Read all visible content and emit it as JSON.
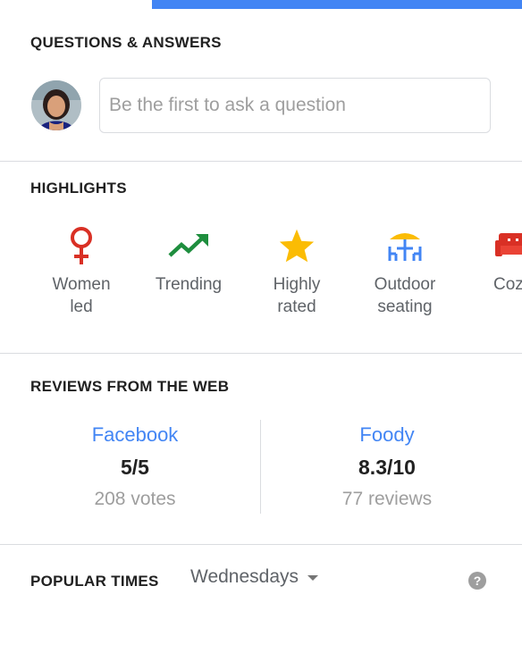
{
  "qa": {
    "title": "QUESTIONS & ANSWERS",
    "input_placeholder": "Be the first to ask a question"
  },
  "highlights": {
    "title": "HIGHLIGHTS",
    "items": [
      {
        "label_line1": "Women",
        "label_line2": "led",
        "icon": "female-symbol-icon",
        "color": "#d93025"
      },
      {
        "label_line1": "Trending",
        "label_line2": "",
        "icon": "trending-up-icon",
        "color": "#1e8e3e"
      },
      {
        "label_line1": "Highly",
        "label_line2": "rated",
        "icon": "star-icon",
        "color": "#fbbc04"
      },
      {
        "label_line1": "Outdoor",
        "label_line2": "seating",
        "icon": "outdoor-seating-icon",
        "color": "#4285f4"
      },
      {
        "label_line1": "Coz",
        "label_line2": "",
        "icon": "sofa-icon",
        "color": "#d93025"
      }
    ]
  },
  "reviews": {
    "title": "REVIEWS FROM THE WEB",
    "sources": [
      {
        "name": "Facebook",
        "score": "5/5",
        "count": "208 votes"
      },
      {
        "name": "Foody",
        "score": "8.3/10",
        "count": "77 reviews"
      }
    ]
  },
  "popular_times": {
    "title": "POPULAR TIMES",
    "selected_day": "Wednesdays",
    "help_glyph": "?"
  },
  "colors": {
    "accent_blue": "#4285f4",
    "divider": "#dadce0"
  }
}
